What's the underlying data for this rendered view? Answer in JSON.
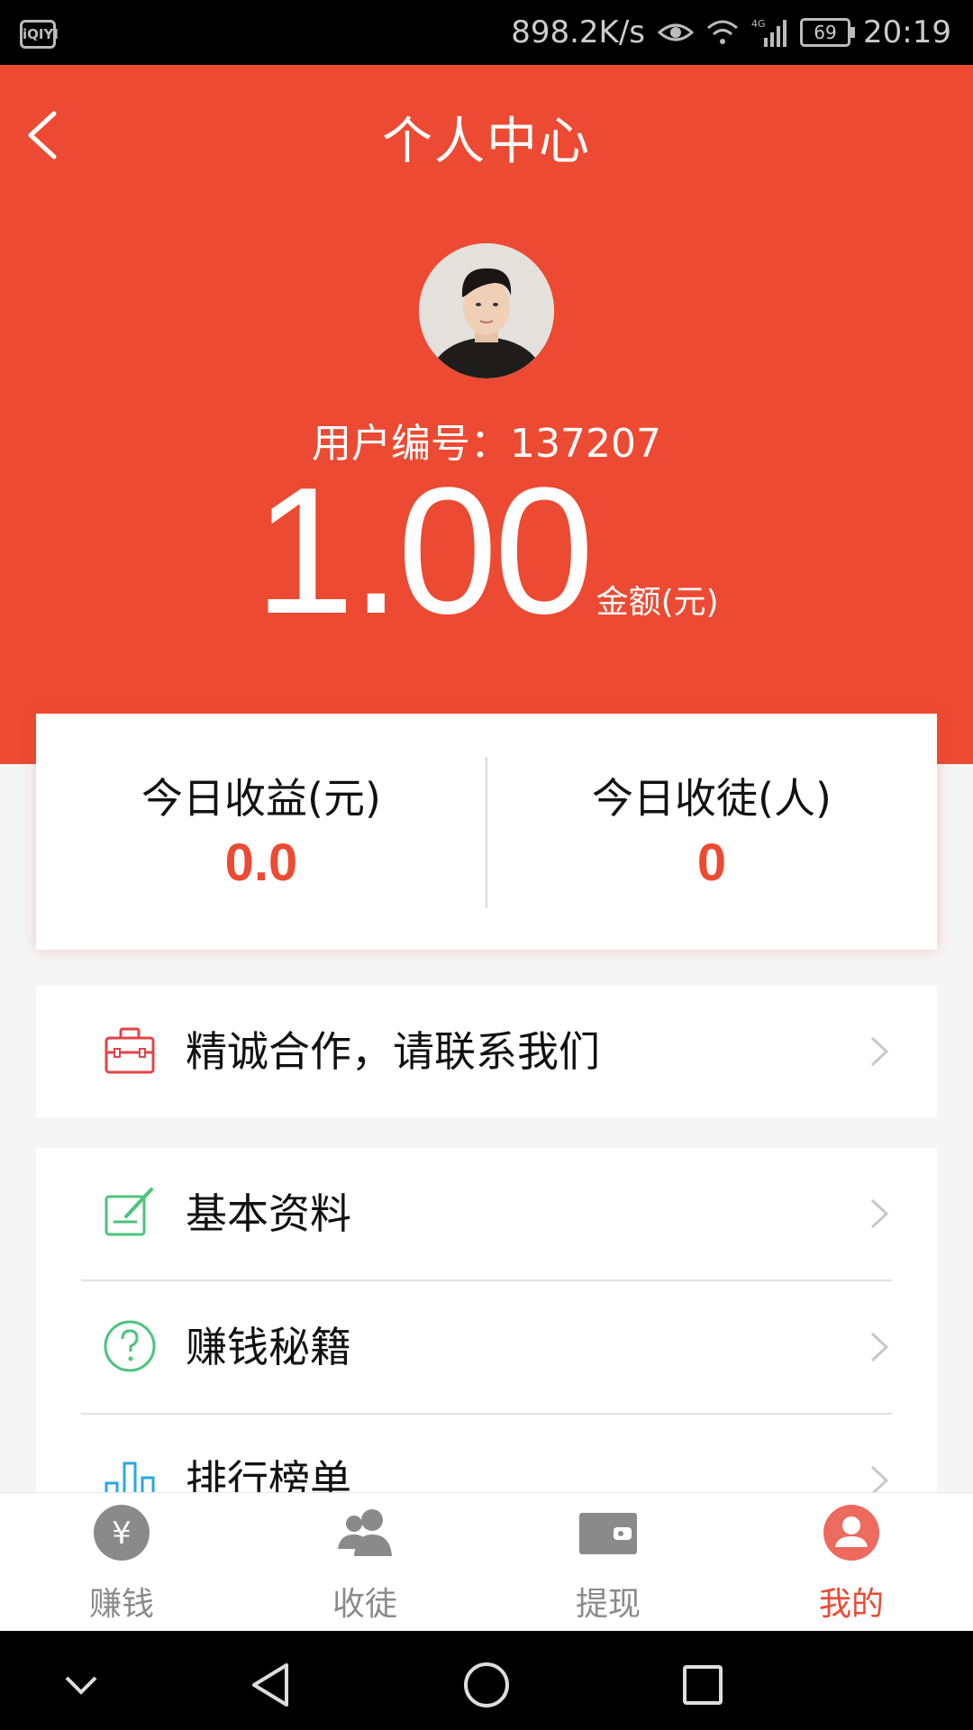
{
  "status_bar": {
    "app_icon_text": "iQIYI",
    "speed": "898.2K/s",
    "network": "4G",
    "battery": "69",
    "time": "20:19"
  },
  "header": {
    "title": "个人中心",
    "user_id": "用户编号：137207",
    "balance": "1.00",
    "balance_unit": "金额(元)"
  },
  "stats": {
    "today_earnings_label": "今日收益(元)",
    "today_earnings_value": "0.0",
    "today_recruits_label": "今日收徒(人)",
    "today_recruits_value": "0"
  },
  "menu": {
    "cooperation": "精诚合作，请联系我们",
    "items": [
      {
        "label": "基本资料",
        "icon": "edit-icon"
      },
      {
        "label": "赚钱秘籍",
        "icon": "question-icon"
      },
      {
        "label": "排行榜单",
        "icon": "bar-chart-icon"
      }
    ]
  },
  "tabs": [
    {
      "label": "赚钱",
      "icon": "yen-icon"
    },
    {
      "label": "收徒",
      "icon": "users-icon"
    },
    {
      "label": "提现",
      "icon": "wallet-icon"
    },
    {
      "label": "我的",
      "icon": "profile-icon"
    }
  ],
  "colors": {
    "brand": "#ec4a32",
    "green_icon": "#4cc47a",
    "blue_icon": "#2aa7e0",
    "inactive_tab": "#8a8a8a"
  }
}
